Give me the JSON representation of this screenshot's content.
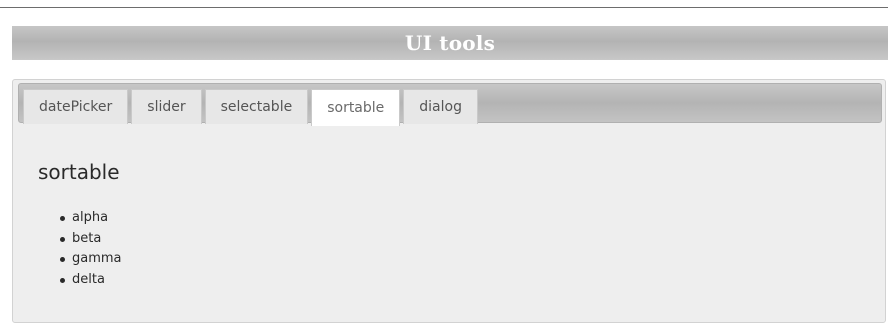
{
  "header": {
    "title": "UI tools"
  },
  "tabs": [
    {
      "label": "datePicker",
      "active": false
    },
    {
      "label": "slider",
      "active": false
    },
    {
      "label": "selectable",
      "active": false
    },
    {
      "label": "sortable",
      "active": true
    },
    {
      "label": "dialog",
      "active": false
    }
  ],
  "content": {
    "heading": "sortable",
    "items": [
      "alpha",
      "beta",
      "gamma",
      "delta"
    ]
  },
  "colors": {
    "banner": "#bdbdbd",
    "panel": "#eeeeee",
    "active_tab": "#ffffff",
    "inactive_tab": "#e7e7e7"
  }
}
